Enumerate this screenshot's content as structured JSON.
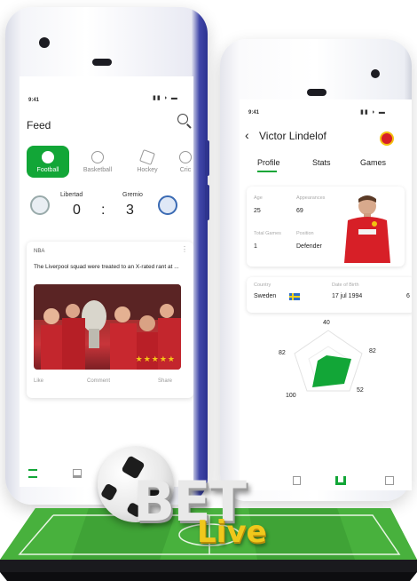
{
  "phone_feed": {
    "status_time": "9:41",
    "title": "Feed",
    "tabs": [
      {
        "label": "Football",
        "active": true
      },
      {
        "label": "Basketball",
        "active": false
      },
      {
        "label": "Hockey",
        "active": false
      },
      {
        "label": "Cric",
        "active": false
      }
    ],
    "match": {
      "home": "Libertad",
      "away": "Gremio",
      "home_score": "0",
      "separator": ":",
      "away_score": "3"
    },
    "post": {
      "tag": "NBA",
      "headline": "The Liverpool squad were treated to an X-rated rant at ...",
      "actions": [
        "Like",
        "Comment",
        "Share"
      ]
    }
  },
  "phone_profile": {
    "status_time": "9:41",
    "player_name": "Victor Lindelof",
    "tabs": [
      "Profile",
      "Stats",
      "Games"
    ],
    "stats": {
      "age_label": "Age",
      "age": "25",
      "appearances_label": "Appearances",
      "appearances": "69",
      "total_games_label": "Total Games",
      "total_games": "1",
      "position_label": "Position",
      "position": "Defender"
    },
    "info": {
      "country_label": "Country",
      "country": "Sweden",
      "dob_label": "Date of Birth",
      "dob": "17 jul 1994",
      "extra": "6"
    },
    "radar": {
      "top": "40",
      "right": "82",
      "left": "82",
      "bottom_left": "100",
      "bottom_right": "52"
    }
  },
  "logo": {
    "word1": "BET",
    "word2": "Live"
  },
  "colors": {
    "accent": "#12a637",
    "phone_edge": "#2c3290",
    "logo_gold": "#f0c81c"
  }
}
